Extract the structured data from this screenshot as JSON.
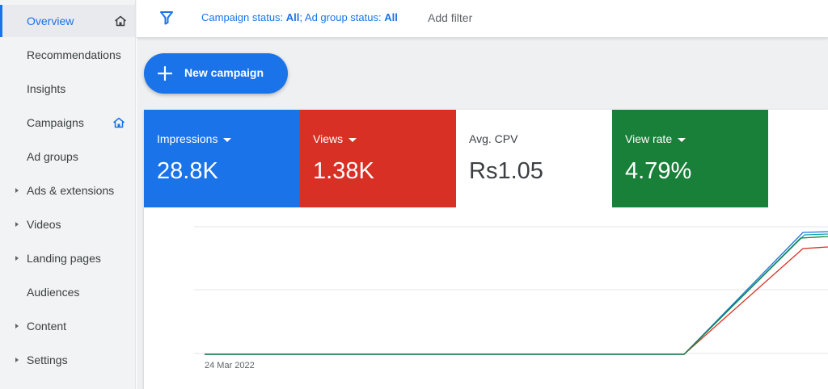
{
  "sidebar": {
    "items": [
      {
        "label": "Overview",
        "active": true,
        "caret": false,
        "home": true
      },
      {
        "label": "Recommendations",
        "active": false,
        "caret": false,
        "home": false
      },
      {
        "label": "Insights",
        "active": false,
        "caret": false,
        "home": false
      },
      {
        "label": "Campaigns",
        "active": false,
        "caret": false,
        "home": true
      },
      {
        "label": "Ad groups",
        "active": false,
        "caret": false,
        "home": false
      },
      {
        "label": "Ads & extensions",
        "active": false,
        "caret": true,
        "home": false
      },
      {
        "label": "Videos",
        "active": false,
        "caret": true,
        "home": false
      },
      {
        "label": "Landing pages",
        "active": false,
        "caret": true,
        "home": false
      },
      {
        "label": "Audiences",
        "active": false,
        "caret": false,
        "home": false
      },
      {
        "label": "Content",
        "active": false,
        "caret": true,
        "home": false
      },
      {
        "label": "Settings",
        "active": false,
        "caret": true,
        "home": false
      }
    ]
  },
  "filterbar": {
    "campaign_status_label": "Campaign status: ",
    "campaign_status_value": "All",
    "separator": "; ",
    "adgroup_status_label": "Ad group status: ",
    "adgroup_status_value": "All",
    "add_filter": "Add filter"
  },
  "new_campaign": {
    "label": "New campaign"
  },
  "metrics": [
    {
      "label": "Impressions",
      "value": "28.8K",
      "color": "#1a73e8",
      "dropdown": true
    },
    {
      "label": "Views",
      "value": "1.38K",
      "color": "#d93025",
      "dropdown": true
    },
    {
      "label": "Avg. CPV",
      "value": "Rs1.05",
      "color": "#ffffff",
      "dropdown": false
    },
    {
      "label": "View rate",
      "value": "4.79%",
      "color": "#188038",
      "dropdown": true
    }
  ],
  "chart": {
    "x_start_label": "24 Mar 2022"
  },
  "colors": {
    "accent": "#1a73e8",
    "red": "#d93025",
    "green": "#188038",
    "teal": "#12a4af"
  }
}
